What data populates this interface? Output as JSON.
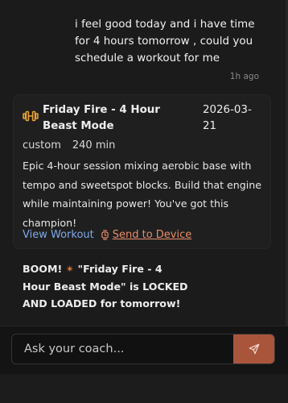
{
  "colors": {
    "background": "#1b1b1b",
    "link_blue": "#7ea9ea",
    "accent_orange": "#e88c6a",
    "send_button": "#a9553c",
    "icon_orange": "#e8a23a"
  },
  "user_message": {
    "text": "i feel good today and i have time for 4 hours tomorrow , could you schedule a workout for me",
    "time": "1h ago"
  },
  "workout_card": {
    "icon": "dumbbell-icon",
    "title": "Friday Fire - 4 Hour Beast Mode",
    "date": "2026-03-21",
    "type": "custom",
    "duration": "240 min",
    "description": "Epic 4-hour session mixing aerobic base with tempo and sweetspot blocks. Build that engine while maintaining power! You've got this champion!",
    "view_label": "View Workout",
    "send_label": "Send to Device",
    "send_icon": "watch-icon"
  },
  "assistant_message": {
    "prefix": "BOOM! ",
    "emoji": "✴",
    "text": " \"Friday Fire - 4 Hour Beast Mode\" is LOCKED AND LOADED for tomorrow!"
  },
  "composer": {
    "placeholder": "Ask your coach...",
    "send_icon": "paper-plane-icon"
  }
}
